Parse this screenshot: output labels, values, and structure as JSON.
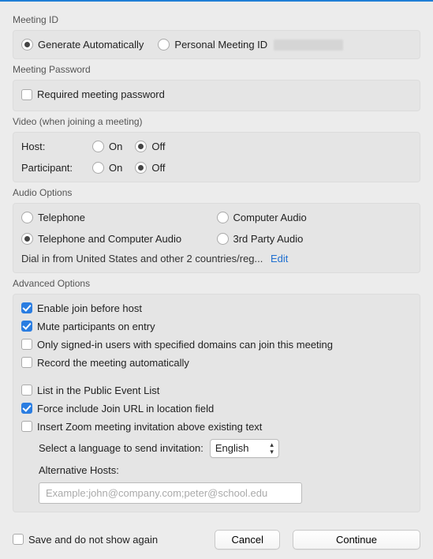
{
  "meeting_id": {
    "label": "Meeting ID",
    "generate": "Generate Automatically",
    "personal": "Personal Meeting ID",
    "selected": "generate"
  },
  "password": {
    "label": "Meeting Password",
    "required_label": "Required meeting password",
    "required": false
  },
  "video": {
    "label": "Video (when joining a meeting)",
    "host_label": "Host:",
    "participant_label": "Participant:",
    "on_label": "On",
    "off_label": "Off",
    "host": "off",
    "participant": "off"
  },
  "audio": {
    "label": "Audio Options",
    "telephone": "Telephone",
    "computer": "Computer Audio",
    "both": "Telephone and Computer Audio",
    "third_party": "3rd Party Audio",
    "selected": "both",
    "dialin_text": "Dial in from United States and other 2 countries/reg...",
    "edit": "Edit"
  },
  "advanced": {
    "label": "Advanced Options",
    "enable_join_before_host": {
      "label": "Enable join before host",
      "value": true
    },
    "mute_on_entry": {
      "label": "Mute participants on entry",
      "value": true
    },
    "only_signed_in": {
      "label": "Only signed-in users with specified domains can join this meeting",
      "value": false
    },
    "record_auto": {
      "label": "Record the meeting automatically",
      "value": false
    },
    "public_event": {
      "label": "List in the Public Event List",
      "value": false
    },
    "force_join_url": {
      "label": "Force include Join URL in location field",
      "value": true
    },
    "insert_invite": {
      "label": "Insert Zoom meeting invitation above existing text",
      "value": false
    },
    "language_label": "Select a language to send invitation:",
    "language_value": "English",
    "alt_hosts_label": "Alternative Hosts:",
    "alt_hosts_placeholder": "Example:john@company.com;peter@school.edu",
    "alt_hosts_value": ""
  },
  "footer": {
    "save_label": "Save and do not show again",
    "save_value": false,
    "cancel": "Cancel",
    "continue": "Continue"
  }
}
